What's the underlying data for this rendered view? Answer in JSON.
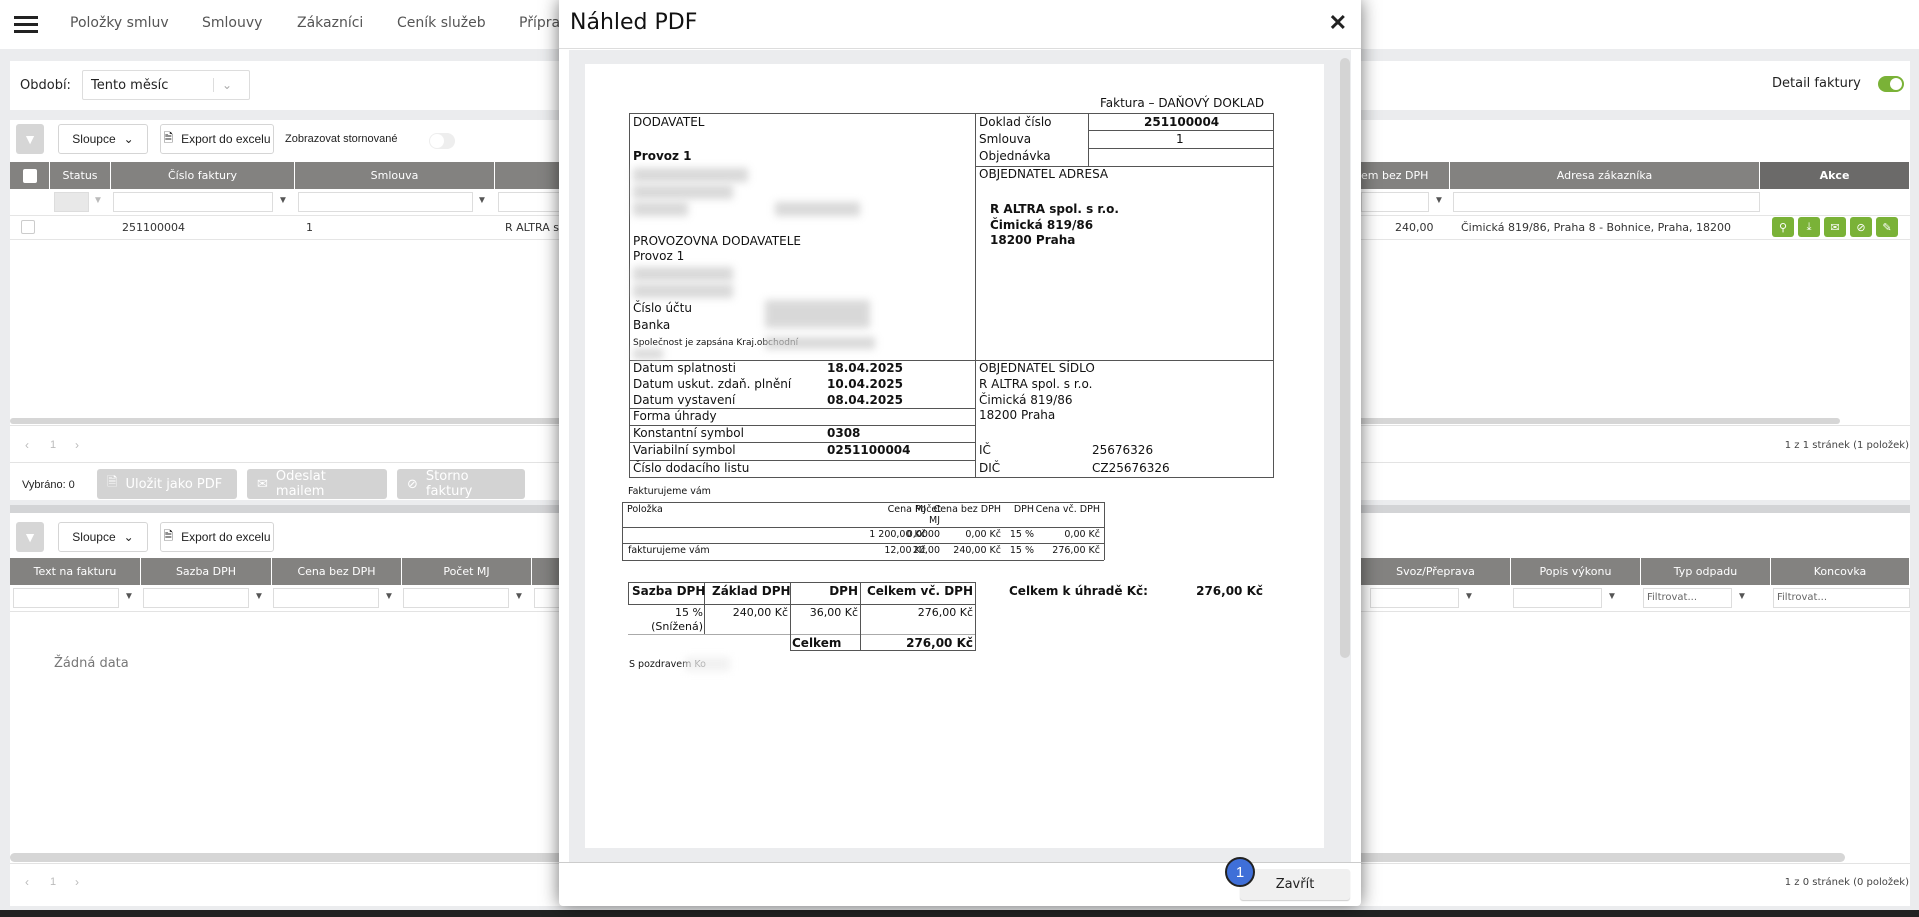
{
  "nav": {
    "items": [
      "Položky smluv",
      "Smlouvy",
      "Zákazníci",
      "Ceník služeb",
      "Příprav"
    ]
  },
  "period": {
    "label": "Období:",
    "value": "Tento měsíc"
  },
  "detail_toggle": {
    "label": "Detail faktury",
    "on": true
  },
  "toolbar1": {
    "columns": "Sloupce",
    "export": "Export do excelu",
    "show_cancelled": "Zobrazovat stornované"
  },
  "table1": {
    "headers": [
      "Status",
      "Číslo faktury",
      "Smlouva",
      "em bez DPH",
      "Adresa zákazníka",
      "Akce"
    ],
    "row": {
      "number": "251100004",
      "contract": "1",
      "customer": "R ALTRA sp",
      "total": "240,00",
      "address": "Čimická 819/86, Praha 8 - Bohnice, Praha, 18200"
    },
    "actions": [
      "search-icon",
      "download-icon",
      "mail-icon",
      "cancel-icon",
      "edit-icon"
    ],
    "pager": {
      "page": "1",
      "summary": "1 z 1 stránek (1 položek)"
    }
  },
  "bulk": {
    "selected": "Vybráno: 0",
    "save_pdf": "Uložit jako PDF",
    "send_mail": "Odeslat mailem",
    "cancel": "Storno faktury"
  },
  "toolbar2": {
    "columns": "Sloupce",
    "export": "Export do excelu"
  },
  "table2": {
    "headers": [
      "Text na fakturu",
      "Sazba DPH",
      "Cena bez DPH",
      "Počet MJ",
      "Svoz/Přeprava",
      "Popis výkonu",
      "Typ odpadu",
      "Koncovka"
    ],
    "filter_placeholder": "Filtrovat...",
    "empty": "Žádná data",
    "pager": {
      "page": "1",
      "summary": "1 z 0 stránek (0 položek)"
    }
  },
  "modal": {
    "title": "Náhled PDF",
    "close_label": "Zavřít",
    "badge": "1"
  },
  "invoice": {
    "doc_title": "Faktura – DAŇOVÝ DOKLAD",
    "supplier": "DODAVATEL",
    "supplier_name": "Provoz 1",
    "branch": "PROVOZOVNA DODAVATELE",
    "branch_name": "Provoz 1",
    "account": "Číslo účtu",
    "bank": "Banka",
    "registry": "Společnost je zapsána Kraj.obchodní",
    "doc_no_label": "Doklad číslo",
    "doc_no": "251100004",
    "contract_label": "Smlouva",
    "contract": "1",
    "order_label": "Objednávka",
    "buyer_addr": "OBJEDNATEL ADRESA",
    "buyer_name": "R ALTRA spol. s r.o.",
    "buyer_street": "Čimická 819/86",
    "buyer_city": "18200  Praha",
    "due_label": "Datum splatnosti",
    "due": "18.04.2025",
    "tax_label": "Datum uskut. zdaň. plnění",
    "tax": "10.04.2025",
    "issue_label": "Datum vystavení",
    "issue": "08.04.2025",
    "payment_label": "Forma úhrady",
    "const_label": "Konstantní symbol",
    "const": "0308",
    "var_label": "Variabilní symbol",
    "var": "0251100004",
    "delivery_label": "Číslo dodacího listu",
    "seat": "OBJEDNATEL SÍDLO",
    "seat_name": "R ALTRA spol. s r.o.",
    "seat_street": "Čimická 819/86",
    "seat_city": "18200  Praha",
    "ic_label": "IČ",
    "ic": "25676326",
    "dic_label": "DIČ",
    "dic": "CZ25676326",
    "items_intro": "Fakturujeme vám",
    "items_headers": [
      "Položka",
      "Počet MJ",
      "Cena MJ",
      "Cena bez DPH",
      "DPH",
      "Cena vč. DPH"
    ],
    "items": [
      [
        "",
        "0,0000",
        "1 200,00 Kč",
        "0,00 Kč",
        "15 %",
        "0,00 Kč"
      ],
      [
        "fakturujeme vám",
        "20,00",
        "12,00 Kč",
        "240,00 Kč",
        "15 %",
        "276,00 Kč"
      ]
    ],
    "vat_headers": [
      "Sazba DPH",
      "Základ DPH",
      "DPH",
      "Celkem vč. DPH"
    ],
    "vat_row": [
      "15 %",
      "(Snížená)",
      "240,00 Kč",
      "36,00 Kč",
      "276,00 Kč"
    ],
    "vat_total_label": "Celkem",
    "vat_total": "276,00 Kč",
    "pay_label": "Celkem k úhradě Kč:",
    "pay": "276,00 Kč",
    "greeting": "S pozdravem Ko"
  },
  "colors": {
    "accent": "#7ab237",
    "header": "#838280",
    "badge": "#3f6fd8"
  }
}
